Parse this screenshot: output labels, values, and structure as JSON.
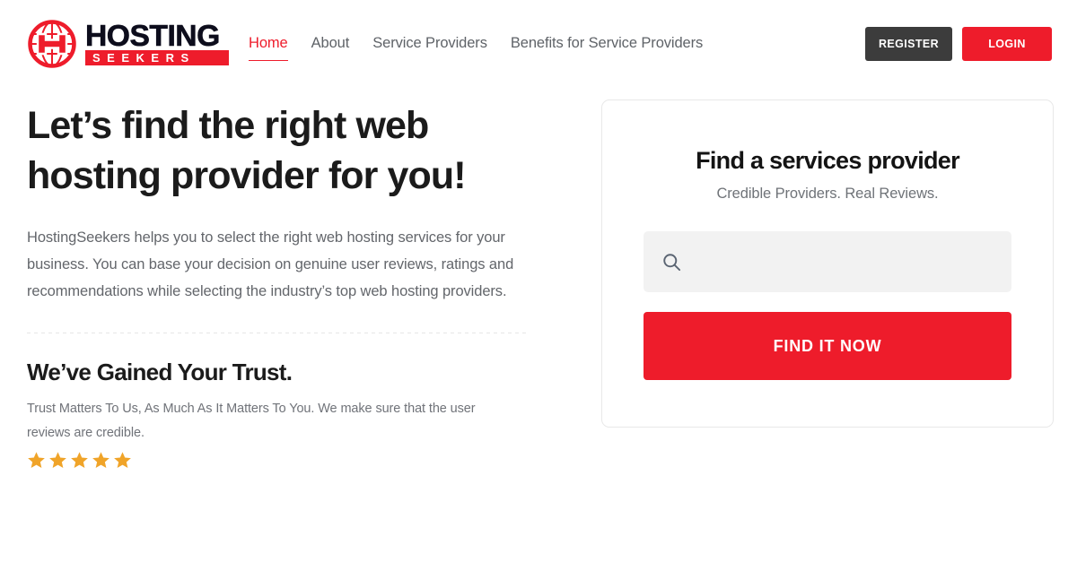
{
  "brand": {
    "name_top": "HOSTING",
    "name_bottom": "SEEKERS",
    "globe_icon": "globe-h-icon"
  },
  "nav": {
    "items": [
      {
        "label": "Home",
        "active": true
      },
      {
        "label": "About",
        "active": false
      },
      {
        "label": "Service Providers",
        "active": false
      },
      {
        "label": "Benefits for Service Providers",
        "active": false
      }
    ]
  },
  "header_actions": {
    "register_label": "REGISTER",
    "login_label": "LOGIN"
  },
  "hero": {
    "headline_line1": "Let’s find the right web",
    "headline_line2": "hosting provider for you!",
    "paragraph": "HostingSeekers helps you to select the right web hosting services for your business. You can base your decision on genuine user reviews, ratings and recommendations while selecting the industry’s top web hosting providers."
  },
  "trust": {
    "title": "We’ve Gained Your Trust.",
    "subtitle": "Trust Matters To Us, As Much As It Matters To You. We make sure that the user reviews are credible.",
    "rating": 5,
    "stars_total": 5,
    "star_icon": "star-icon"
  },
  "search_card": {
    "title": "Find a services provider",
    "subtitle": "Credible Providers. Real Reviews.",
    "search_icon": "search-icon",
    "search_value": "",
    "search_placeholder": "",
    "submit_label": "FIND IT NOW"
  },
  "colors": {
    "brand_red": "#ee1c2b",
    "register_dark": "#3c3c3c",
    "star_gold": "#f0a429",
    "nav_gray": "#5f6368",
    "body_gray": "#63666b",
    "heading_dark": "#1b1b1b",
    "input_bg": "#f2f2f2",
    "card_border": "#e8e8e8"
  }
}
